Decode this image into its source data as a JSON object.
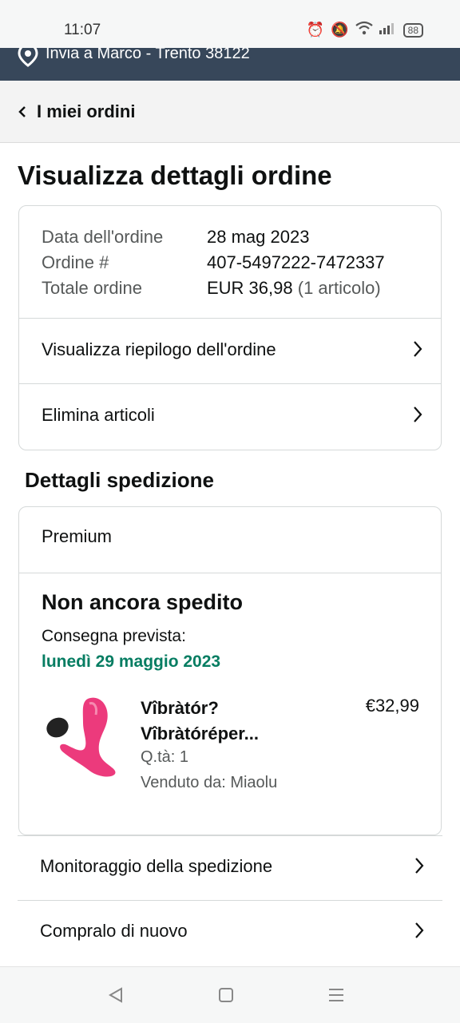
{
  "status_bar": {
    "time": "11:07",
    "battery": "88"
  },
  "delivery_bar": {
    "text": "Invia a Marco - Trento 38122"
  },
  "back_nav": {
    "label": "I miei ordini"
  },
  "page_title": "Visualizza dettagli ordine",
  "order_summary": {
    "date_label": "Data dell'ordine",
    "date_value": "28 mag 2023",
    "order_label": "Ordine #",
    "order_value": "407-5497222-7472337",
    "total_label": "Totale ordine",
    "total_value": "EUR 36,98",
    "total_items": "(1 articolo)",
    "links": [
      "Visualizza riepilogo dell'ordine",
      "Elimina articoli"
    ]
  },
  "shipping": {
    "section_title": "Dettagli spedizione",
    "method": "Premium",
    "status": "Non ancora spedito",
    "delivery_label": "Consegna prevista:",
    "delivery_date": "lunedì 29 maggio 2023",
    "item": {
      "name_line1": "Vîbràtór?",
      "name_line2": "Vîbràtóréper...",
      "price": "€32,99",
      "qty": "Q.tà: 1",
      "seller": "Venduto da: Miaolu"
    }
  },
  "actions": [
    "Monitoraggio della spedizione",
    "Compralo di nuovo"
  ],
  "colors": {
    "header": "#37475a",
    "delivery_green": "#067d62",
    "border": "#d5d9d9"
  }
}
